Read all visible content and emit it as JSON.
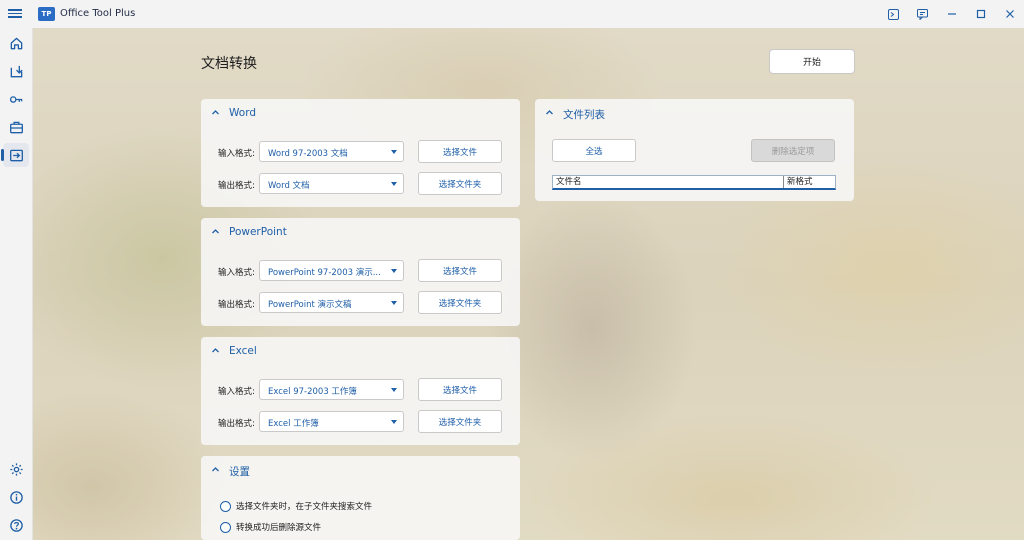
{
  "window": {
    "app_title": "Office Tool Plus",
    "logo_text": "TP",
    "buttons": [
      "terminal-icon",
      "feedback-icon",
      "minimize-icon",
      "maximize-icon",
      "close-icon"
    ]
  },
  "nav": {
    "items": [
      "home-icon",
      "deploy-icon",
      "activate-icon",
      "toolbox-icon",
      "convert-icon"
    ],
    "active": "convert-icon",
    "bottom_items": [
      "settings-icon",
      "about-icon",
      "help-icon"
    ]
  },
  "page": {
    "title": "文档转换",
    "start_label": "开始"
  },
  "word": {
    "title": "Word",
    "input_label": "输入格式:",
    "input_value": "Word 97-2003 文档",
    "output_label": "输出格式:",
    "output_value": "Word 文档",
    "select_file": "选择文件",
    "select_folder": "选择文件夹"
  },
  "powerpoint": {
    "title": "PowerPoint",
    "input_label": "输入格式:",
    "input_value": "PowerPoint 97-2003 演示...",
    "output_label": "输出格式:",
    "output_value": "PowerPoint 演示文稿",
    "select_file": "选择文件",
    "select_folder": "选择文件夹"
  },
  "excel": {
    "title": "Excel",
    "input_label": "输入格式:",
    "input_value": "Excel 97-2003 工作簿",
    "output_label": "输出格式:",
    "output_value": "Excel 工作簿",
    "select_file": "选择文件",
    "select_folder": "选择文件夹"
  },
  "settings": {
    "title": "设置",
    "option1": "选择文件夹时，在子文件夹搜索文件",
    "option2": "转换成功后删除源文件"
  },
  "file_list": {
    "title": "文件列表",
    "select_all": "全选",
    "remove_selected": "删除选定项",
    "columns": [
      "文件名",
      "新格式"
    ]
  },
  "colors": {
    "accent": "#1f5fa8",
    "titlebar": "#f3f3f3",
    "card": "#f7f7f7"
  }
}
